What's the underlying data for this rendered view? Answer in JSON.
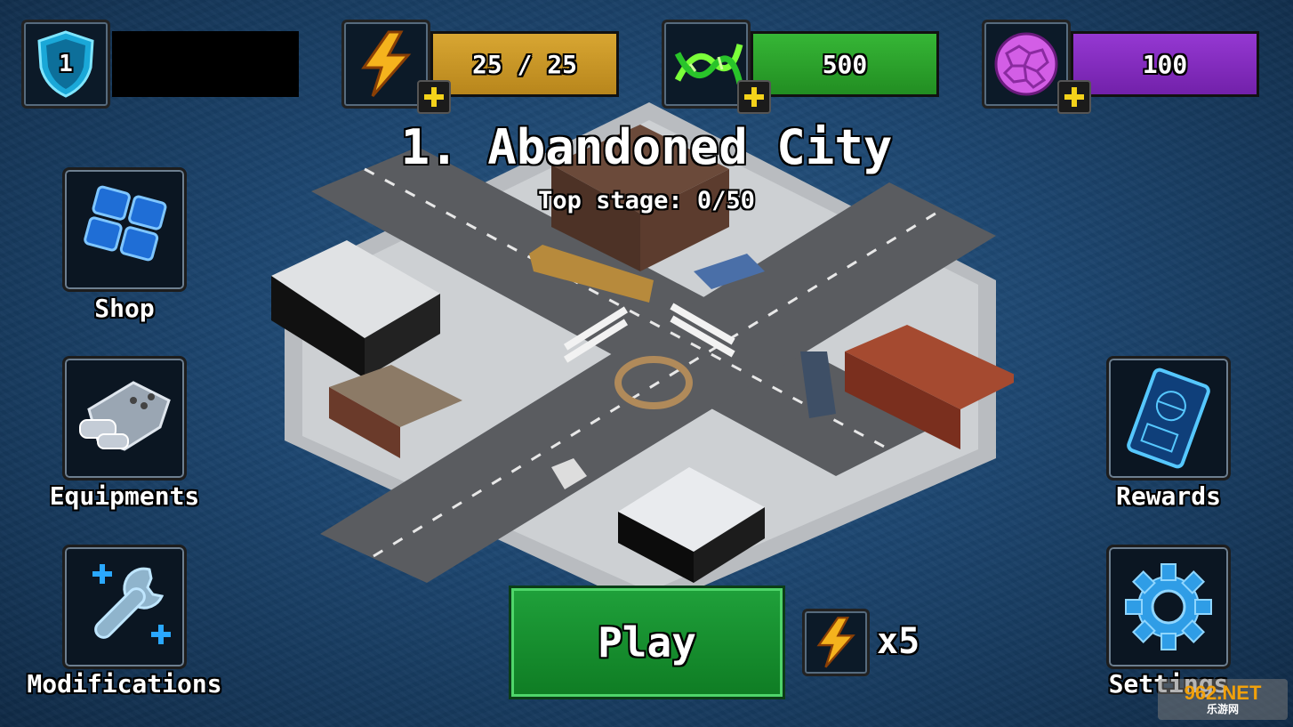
{
  "level": {
    "value": "1",
    "icon": "shield-icon"
  },
  "resources": {
    "energy": {
      "value": "25 / 25",
      "icon": "lightning-icon",
      "color": "#d4a12a"
    },
    "dna": {
      "value": "500",
      "icon": "dna-icon",
      "color": "#2ea82e"
    },
    "orb": {
      "value": "100",
      "icon": "purple-orb-icon",
      "color": "#8a2dc4"
    }
  },
  "stage": {
    "title": "1. Abandoned City",
    "subtitle": "Top stage: 0/50"
  },
  "menu": {
    "shop": "Shop",
    "equipments": "Equipments",
    "modifications": "Modifications",
    "rewards": "Rewards",
    "settings": "Settings"
  },
  "play": {
    "label": "Play",
    "cost": "x5",
    "cost_icon": "lightning-icon"
  },
  "watermark": {
    "top": "962.NET",
    "bottom": "乐游网"
  }
}
